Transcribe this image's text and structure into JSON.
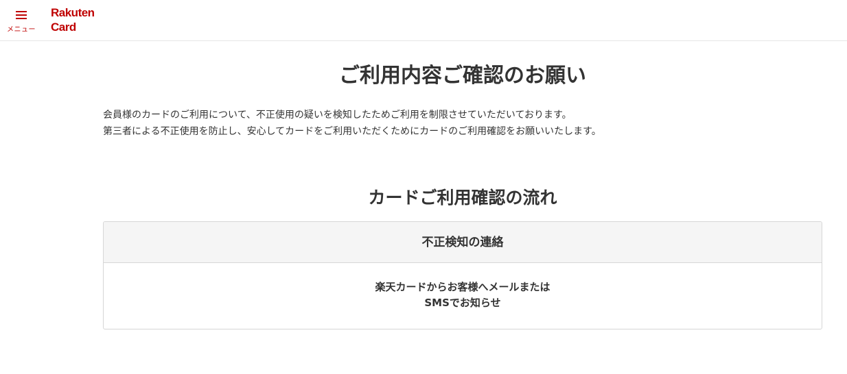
{
  "header": {
    "menu_label": "メニュー",
    "logo_line1": "Rakuten",
    "logo_line2": "Card",
    "brand_color": "#bf0000"
  },
  "main": {
    "title": "ご利用内容ご確認のお願い",
    "intro": [
      "会員様のカードのご利用について、不正使用の疑いを検知したためご利用を制限させていただいております。",
      "第三者による不正使用を防止し、安心してカードをご利用いただくためにカードのご利用確認をお願いいたします。"
    ],
    "section_title": "カードご利用確認の流れ",
    "flow_step": {
      "heading": "不正検知の連絡",
      "body_line1": "楽天カードからお客様へメールまたは",
      "body_line2": "SMSでお知らせ"
    }
  }
}
